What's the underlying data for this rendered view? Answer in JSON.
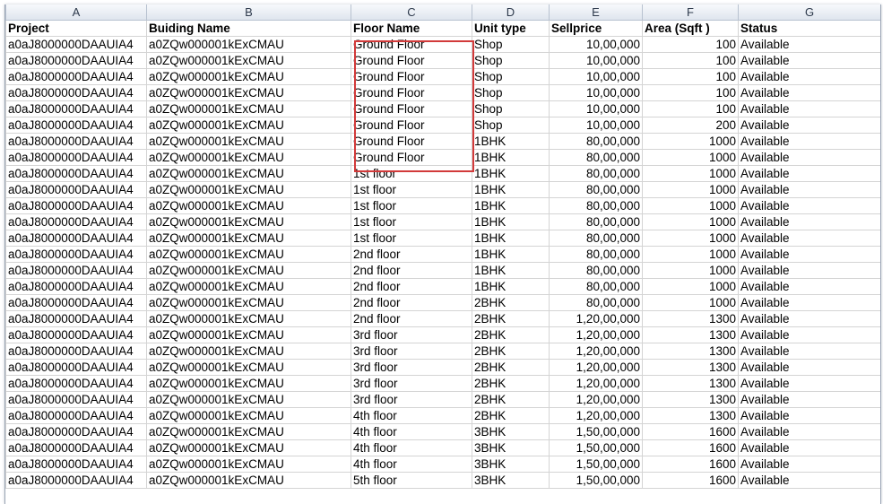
{
  "columns": [
    "A",
    "B",
    "C",
    "D",
    "E",
    "F",
    "G"
  ],
  "headers": [
    "Project",
    "Buiding Name",
    "Floor Name",
    "Unit type",
    "Sellprice",
    "Area (Sqft )",
    "Status"
  ],
  "rows": [
    [
      "a0aJ8000000DAAUIA4",
      "a0ZQw000001kExCMAU",
      "Ground Floor",
      "Shop",
      "10,00,000",
      "100",
      "Available"
    ],
    [
      "a0aJ8000000DAAUIA4",
      "a0ZQw000001kExCMAU",
      "Ground Floor",
      "Shop",
      "10,00,000",
      "100",
      "Available"
    ],
    [
      "a0aJ8000000DAAUIA4",
      "a0ZQw000001kExCMAU",
      "Ground Floor",
      "Shop",
      "10,00,000",
      "100",
      "Available"
    ],
    [
      "a0aJ8000000DAAUIA4",
      "a0ZQw000001kExCMAU",
      "Ground Floor",
      "Shop",
      "10,00,000",
      "100",
      "Available"
    ],
    [
      "a0aJ8000000DAAUIA4",
      "a0ZQw000001kExCMAU",
      "Ground Floor",
      "Shop",
      "10,00,000",
      "100",
      "Available"
    ],
    [
      "a0aJ8000000DAAUIA4",
      "a0ZQw000001kExCMAU",
      "Ground Floor",
      "Shop",
      "10,00,000",
      "200",
      "Available"
    ],
    [
      "a0aJ8000000DAAUIA4",
      "a0ZQw000001kExCMAU",
      "Ground Floor",
      "1BHK",
      "80,00,000",
      "1000",
      "Available"
    ],
    [
      "a0aJ8000000DAAUIA4",
      "a0ZQw000001kExCMAU",
      "Ground Floor",
      "1BHK",
      "80,00,000",
      "1000",
      "Available"
    ],
    [
      "a0aJ8000000DAAUIA4",
      "a0ZQw000001kExCMAU",
      "1st floor",
      "1BHK",
      "80,00,000",
      "1000",
      "Available"
    ],
    [
      "a0aJ8000000DAAUIA4",
      "a0ZQw000001kExCMAU",
      "1st floor",
      "1BHK",
      "80,00,000",
      "1000",
      "Available"
    ],
    [
      "a0aJ8000000DAAUIA4",
      "a0ZQw000001kExCMAU",
      "1st floor",
      "1BHK",
      "80,00,000",
      "1000",
      "Available"
    ],
    [
      "a0aJ8000000DAAUIA4",
      "a0ZQw000001kExCMAU",
      "1st floor",
      "1BHK",
      "80,00,000",
      "1000",
      "Available"
    ],
    [
      "a0aJ8000000DAAUIA4",
      "a0ZQw000001kExCMAU",
      "1st floor",
      "1BHK",
      "80,00,000",
      "1000",
      "Available"
    ],
    [
      "a0aJ8000000DAAUIA4",
      "a0ZQw000001kExCMAU",
      "2nd floor",
      "1BHK",
      "80,00,000",
      "1000",
      "Available"
    ],
    [
      "a0aJ8000000DAAUIA4",
      "a0ZQw000001kExCMAU",
      "2nd floor",
      "1BHK",
      "80,00,000",
      "1000",
      "Available"
    ],
    [
      "a0aJ8000000DAAUIA4",
      "a0ZQw000001kExCMAU",
      "2nd floor",
      "1BHK",
      "80,00,000",
      "1000",
      "Available"
    ],
    [
      "a0aJ8000000DAAUIA4",
      "a0ZQw000001kExCMAU",
      "2nd floor",
      "2BHK",
      "80,00,000",
      "1000",
      "Available"
    ],
    [
      "a0aJ8000000DAAUIA4",
      "a0ZQw000001kExCMAU",
      "2nd floor",
      "2BHK",
      "1,20,00,000",
      "1300",
      "Available"
    ],
    [
      "a0aJ8000000DAAUIA4",
      "a0ZQw000001kExCMAU",
      "3rd floor",
      "2BHK",
      "1,20,00,000",
      "1300",
      "Available"
    ],
    [
      "a0aJ8000000DAAUIA4",
      "a0ZQw000001kExCMAU",
      "3rd floor",
      "2BHK",
      "1,20,00,000",
      "1300",
      "Available"
    ],
    [
      "a0aJ8000000DAAUIA4",
      "a0ZQw000001kExCMAU",
      "3rd floor",
      "2BHK",
      "1,20,00,000",
      "1300",
      "Available"
    ],
    [
      "a0aJ8000000DAAUIA4",
      "a0ZQw000001kExCMAU",
      "3rd floor",
      "2BHK",
      "1,20,00,000",
      "1300",
      "Available"
    ],
    [
      "a0aJ8000000DAAUIA4",
      "a0ZQw000001kExCMAU",
      "3rd floor",
      "2BHK",
      "1,20,00,000",
      "1300",
      "Available"
    ],
    [
      "a0aJ8000000DAAUIA4",
      "a0ZQw000001kExCMAU",
      "4th floor",
      "2BHK",
      "1,20,00,000",
      "1300",
      "Available"
    ],
    [
      "a0aJ8000000DAAUIA4",
      "a0ZQw000001kExCMAU",
      "4th floor",
      "3BHK",
      "1,50,00,000",
      "1600",
      "Available"
    ],
    [
      "a0aJ8000000DAAUIA4",
      "a0ZQw000001kExCMAU",
      "4th floor",
      "3BHK",
      "1,50,00,000",
      "1600",
      "Available"
    ],
    [
      "a0aJ8000000DAAUIA4",
      "a0ZQw000001kExCMAU",
      "4th floor",
      "3BHK",
      "1,50,00,000",
      "1600",
      "Available"
    ],
    [
      "a0aJ8000000DAAUIA4",
      "a0ZQw000001kExCMAU",
      "5th floor",
      "3BHK",
      "1,50,00,000",
      "1600",
      "Available"
    ]
  ],
  "colors": {
    "highlight": "#d23a3a",
    "header_bg": "#dfe5ee"
  }
}
